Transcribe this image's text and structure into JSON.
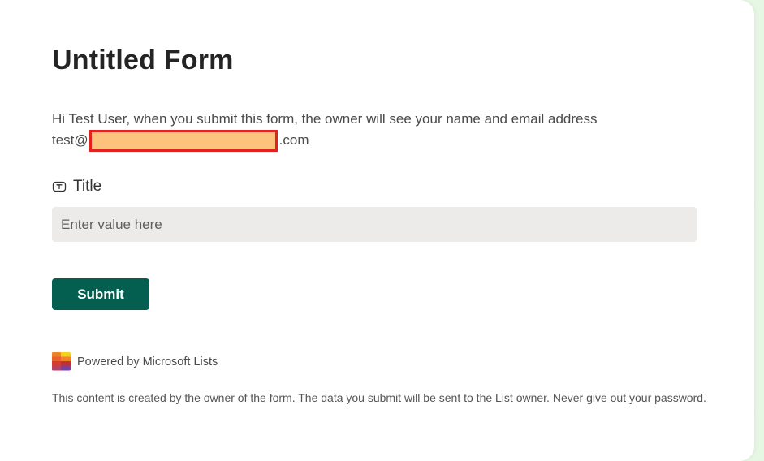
{
  "form": {
    "title": "Untitled Form",
    "intro_text": "Hi Test User, when you submit this form, the owner will see your name and email address",
    "email_prefix": "test@",
    "email_suffix": ".com",
    "field": {
      "label": "Title",
      "icon": "text-field-icon",
      "placeholder": "Enter value here",
      "value": ""
    },
    "submit_label": "Submit"
  },
  "footer": {
    "powered_by": "Powered by Microsoft Lists",
    "logo_icon": "microsoft-lists-logo",
    "disclaimer": "This content is created by the owner of the form. The data you submit will be sent to the List owner. Never give out your password."
  },
  "colors": {
    "submit_bg": "#045f50",
    "input_bg": "#edebe9",
    "redaction_fill": "#fdc27c",
    "redaction_border": "#e3211f"
  }
}
